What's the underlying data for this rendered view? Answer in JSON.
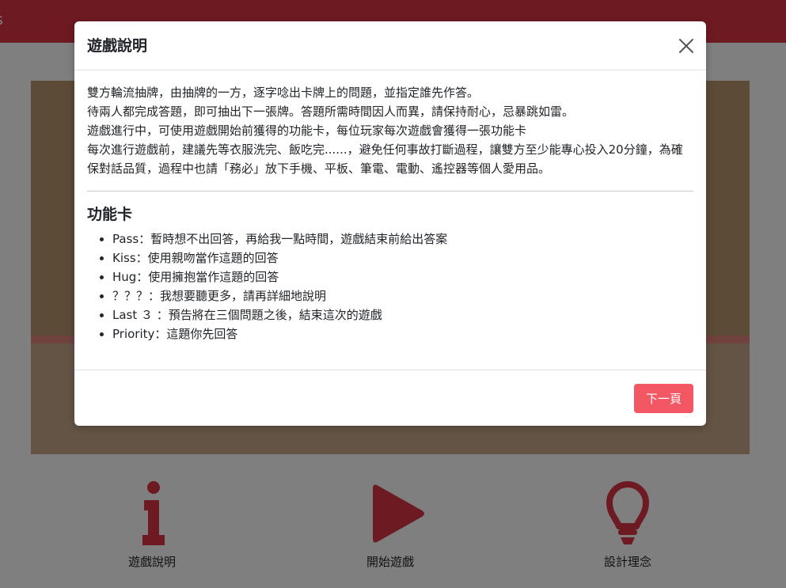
{
  "app": {
    "brand": "s"
  },
  "menu": {
    "items": [
      {
        "label": "遊戲說明",
        "icon": "info-icon"
      },
      {
        "label": "開始遊戲",
        "icon": "play-icon"
      },
      {
        "label": "設計理念",
        "icon": "lightbulb-icon"
      }
    ]
  },
  "modal": {
    "title": "遊戲說明",
    "close_icon": "close-icon",
    "intro": [
      "雙方輪流抽牌，由抽牌的一方，逐字唸出卡牌上的問題，並指定誰先作答。",
      "待兩人都完成答題，即可抽出下一張牌。答題所需時間因人而異，請保持耐心，忌暴跳如雷。",
      "遊戲進行中，可使用遊戲開始前獲得的功能卡，每位玩家每次遊戲會獲得一張功能卡",
      "每次進行遊戲前，建議先等衣服洗完、飯吃完......，避免任何事故打斷過程，讓雙方至少能專心投入20分鐘，為確保對話品質，過程中也請「務必」放下手機、平板、筆電、電動、遙控器等個人愛用品。"
    ],
    "section_title": "功能卡",
    "features": [
      "Pass：暫時想不出回答，再給我一點時間，遊戲結束前給出答案",
      "Kiss：使用親吻當作這題的回答",
      "Hug：使用擁抱當作這題的回答",
      "？？？：我想要聽更多，請再詳細地說明",
      "Last ３ ：預告將在三個問題之後，結束這次的遊戲",
      "Priority：這題你先回答"
    ],
    "next_button": "下一頁"
  },
  "colors": {
    "brand": "#dc3545",
    "accent": "#a4222d",
    "button": "#f25763"
  }
}
